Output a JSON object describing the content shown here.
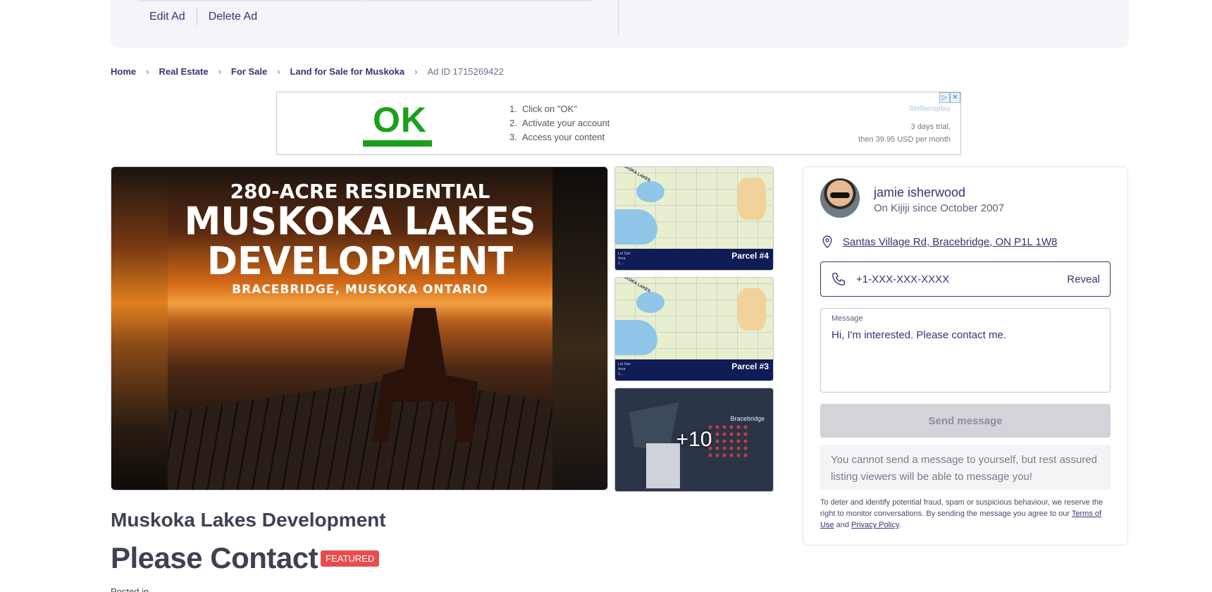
{
  "top_actions": {
    "edit_label": "Edit Ad",
    "delete_label": "Delete Ad"
  },
  "breadcrumb": {
    "items": [
      "Home",
      "Real Estate",
      "For Sale",
      "Land for Sale for Muskoka"
    ],
    "ad_id": "Ad ID 1715269422"
  },
  "ad_banner": {
    "button_text": "OK",
    "steps": [
      "Click on \"OK\"",
      "Activate your account",
      "Access your content"
    ],
    "step_numbers": [
      "1.",
      "2.",
      "3."
    ],
    "brand": "Stellarisplay",
    "trial_line1": "3 days trial,",
    "trial_line2": "then 39.95 USD per month",
    "ad_choices": "▷",
    "close": "✕"
  },
  "gallery": {
    "main_image": {
      "line1": "280-ACRE RESIDENTIAL",
      "line2": "MUSKOKA LAKES",
      "line3": "DEVELOPMENT",
      "line4": "BRACEBRIDGE, MUSKOKA ONTARIO"
    },
    "thumbs": [
      {
        "caption": "Parcel #4",
        "map_label": "MUSKOKA LAKES"
      },
      {
        "caption": "Parcel #3",
        "map_label": "MUSKOKA LAKES"
      },
      {
        "town": "Bracebridge",
        "more": "+10"
      }
    ]
  },
  "seller": {
    "name": "jamie isherwood",
    "since": "On Kijiji since October 2007",
    "address": "Santas Village Rd, Bracebridge, ON P1L 1W8",
    "phone": "+1-XXX-XXX-XXXX",
    "reveal_label": "Reveal",
    "message_label": "Message",
    "message_value": "Hi, I'm interested. Please contact me.",
    "send_label": "Send message",
    "notice": "You cannot send a message to yourself, but rest assured listing viewers will be able to message you!",
    "legal_prefix": "To deter and identify potential fraud, spam or suspicious behaviour, we reserve the right to monitor conversations. By sending the message you agree to our ",
    "terms_label": "Terms of Use",
    "legal_and": " and ",
    "privacy_label": "Privacy Policy",
    "legal_end": "."
  },
  "listing": {
    "title": "Muskoka Lakes Development",
    "price": "Please Contact",
    "badge": "FEATURED",
    "posted": "Posted in..."
  },
  "colors": {
    "accent": "#373373",
    "featured": "#e84d4d",
    "ok_green": "#1aa01a"
  }
}
